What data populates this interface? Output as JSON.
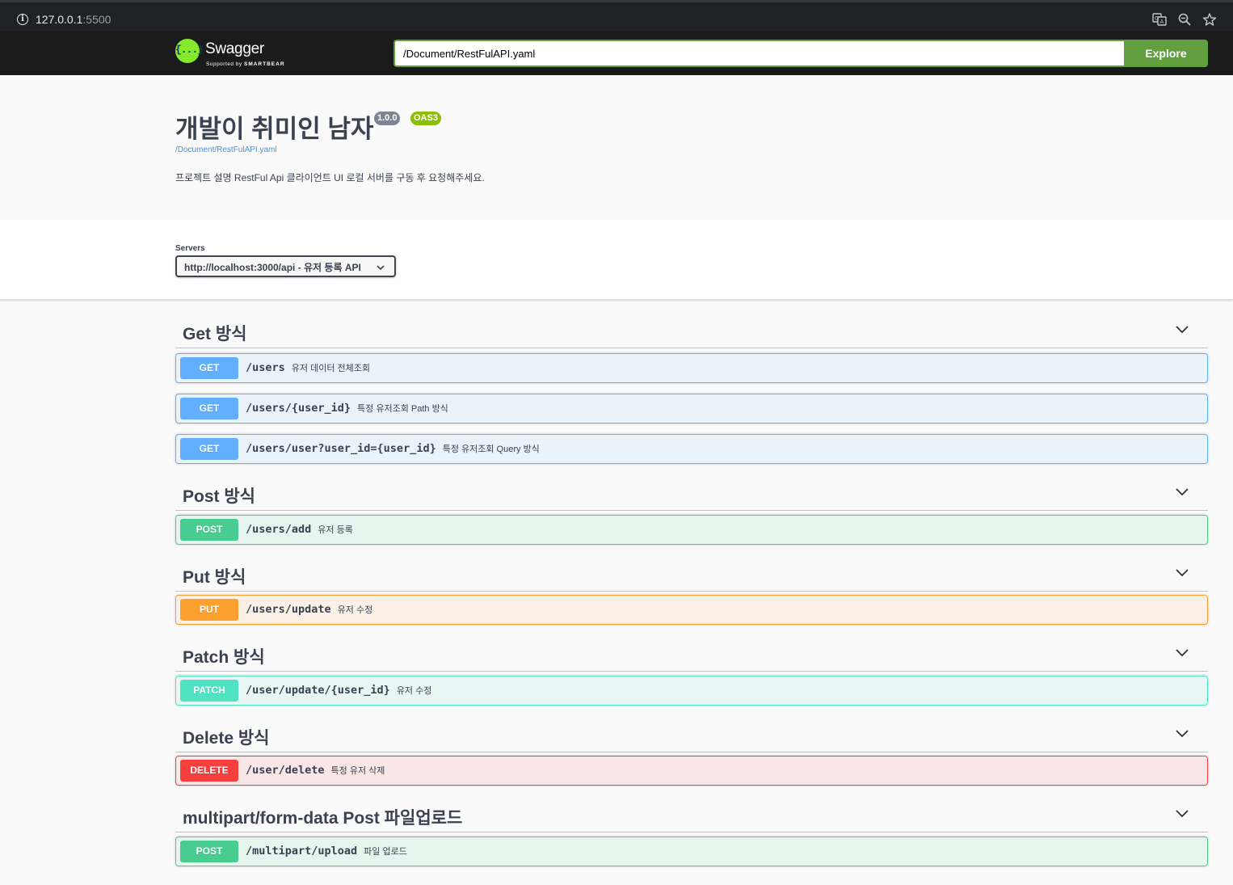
{
  "browser": {
    "url_host": "127.0.0.1",
    "url_port": ":5500"
  },
  "topbar": {
    "logo_title": "Swagger",
    "logo_sub_prefix": "Supported by ",
    "logo_sub_brand": "SMARTBEAR",
    "logo_glyph": "{...}",
    "spec_url_value": "/Document/RestFulAPI.yaml",
    "explore_label": "Explore",
    "accent_color": "#62a03f"
  },
  "info": {
    "title": "개발이 취미인 남자",
    "version": "1.0.0",
    "oas_badge": "OAS3",
    "spec_link": "/Document/RestFulAPI.yaml",
    "description": "프로젝트 설명 RestFul Api 클라이언트 UI 로컬 서버를 구동 후 요청해주세요."
  },
  "servers": {
    "label": "Servers",
    "selected": "http://localhost:3000/api - 유저 등록 API"
  },
  "tags": [
    {
      "name": "Get 방식",
      "operations": [
        {
          "method": "GET",
          "path": "/users",
          "summary": "유저 데이터 전체조회"
        },
        {
          "method": "GET",
          "path": "/users/{user_id}",
          "summary": "특정 유저조회 Path 방식"
        },
        {
          "method": "GET",
          "path": "/users/user?user_id={user_id}",
          "summary": "특정 유저조회 Query 방식"
        }
      ]
    },
    {
      "name": "Post 방식",
      "operations": [
        {
          "method": "POST",
          "path": "/users/add",
          "summary": "유저 등록"
        }
      ]
    },
    {
      "name": "Put 방식",
      "operations": [
        {
          "method": "PUT",
          "path": "/users/update",
          "summary": "유저 수정"
        }
      ]
    },
    {
      "name": "Patch 방식",
      "operations": [
        {
          "method": "PATCH",
          "path": "/user/update/{user_id}",
          "summary": "유저 수정"
        }
      ]
    },
    {
      "name": "Delete 방식",
      "operations": [
        {
          "method": "DELETE",
          "path": "/user/delete",
          "summary": "특정 유저 삭제"
        }
      ]
    },
    {
      "name": "multipart/form-data Post 파일업로드",
      "operations": [
        {
          "method": "POST",
          "path": "/multipart/upload",
          "summary": "파일 업로드"
        }
      ]
    }
  ],
  "method_colors": {
    "GET": "#61affe",
    "POST": "#49cc90",
    "PUT": "#fca130",
    "PATCH": "#50e3c2",
    "DELETE": "#f93e3e"
  }
}
